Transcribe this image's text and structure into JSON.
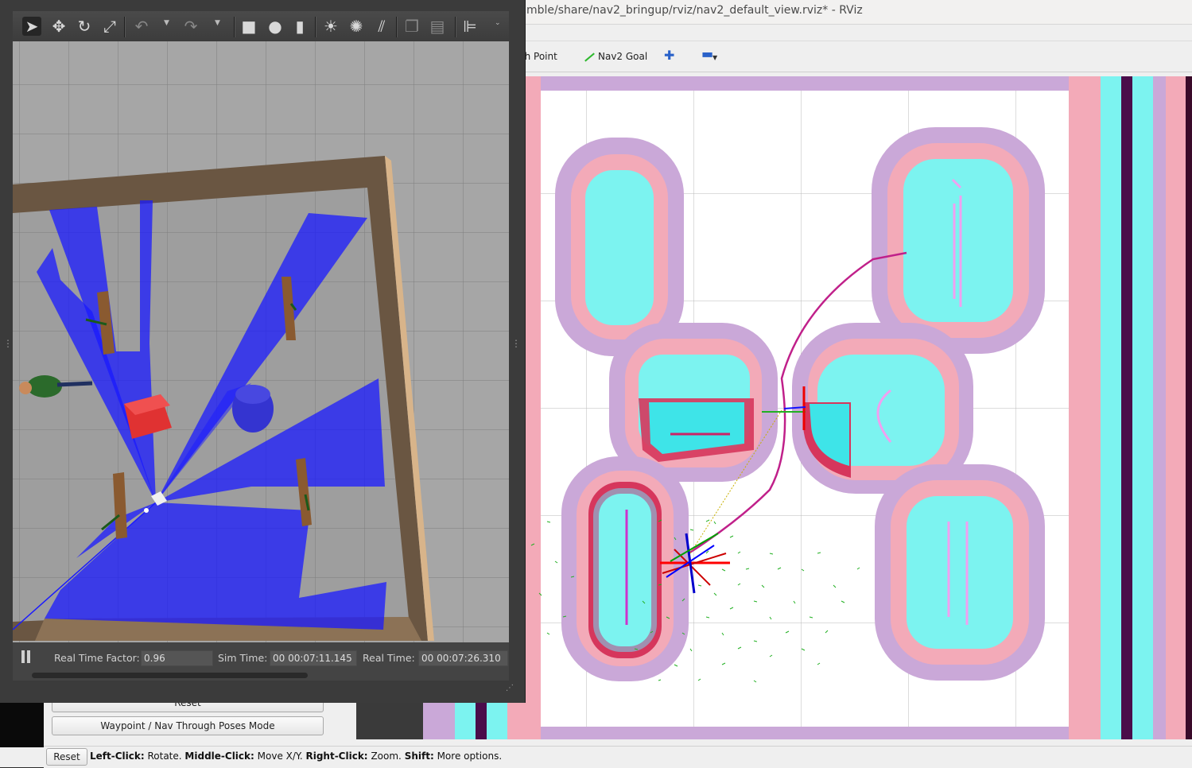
{
  "rviz": {
    "window_title": "mble/share/nav2_bringup/rviz/nav2_default_view.rviz* - RViz",
    "toolbar": {
      "publish_point_label": "ish Point",
      "nav2_goal_label": "Nav2 Goal",
      "add_tool_icon": "plus-icon",
      "remove_tool_icon": "minus-icon"
    },
    "panel": {
      "reset_button_label": "Reset",
      "waypoint_button_label": "Waypoint / Nav Through Poses Mode"
    },
    "status_bar": {
      "reset_label": "Reset",
      "hint_left_click": "Left-Click:",
      "hint_rotate": "Rotate.",
      "hint_middle_click": "Middle-Click:",
      "hint_move": "Move X/Y.",
      "hint_right_click": "Right-Click:",
      "hint_zoom": "Zoom.",
      "hint_shift": "Shift:",
      "hint_more": "More options."
    },
    "colors": {
      "costmap_inflation": "#caa8d8",
      "costmap_high": "#f3aab8",
      "costmap_lethal": "#7cf3f0",
      "costmap_obstacle": "#d6365c",
      "path": "#c0208a",
      "particles": "#22b022"
    }
  },
  "gazebo": {
    "toolbar_icons": [
      "select-arrow-icon",
      "translate-icon",
      "rotate-icon",
      "scale-icon",
      "undo-icon",
      "redo-icon",
      "box-icon",
      "sphere-icon",
      "cylinder-icon",
      "sun-light-icon",
      "point-light-icon",
      "directional-light-icon",
      "copy-icon",
      "paste-icon",
      "align-icon"
    ],
    "real_time_factor_label": "Real Time Factor:",
    "real_time_factor": "0.96",
    "sim_time_label": "Sim Time:",
    "sim_time": "00 00:07:11.145",
    "real_time_label": "Real Time:",
    "real_time": "00 00:07:26.310",
    "colors": {
      "laser": "#1a1aff",
      "wall": "#6a5642",
      "floor": "#9a9a9a",
      "box": "#d62a2a"
    }
  }
}
